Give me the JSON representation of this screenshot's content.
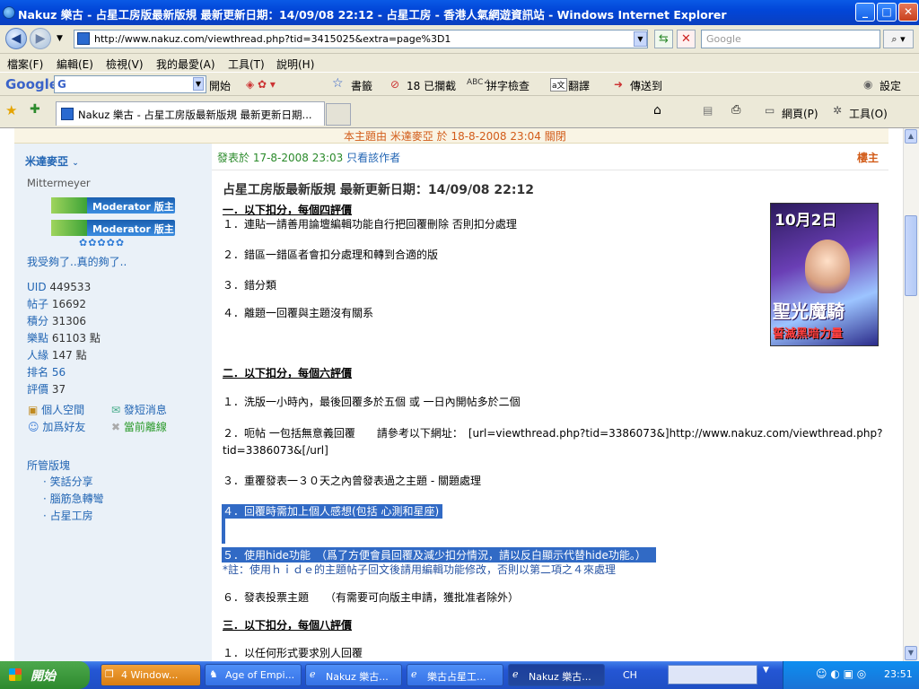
{
  "window": {
    "title": "Nakuz 樂古 - 占星工房版最新版規 最新更新日期：14/09/08 22:12 - 占星工房 - 香港人氣網遊資訊站 - Windows Internet Explorer",
    "btn_min": "_",
    "btn_max": "□",
    "btn_close": "✕"
  },
  "address": {
    "url": "http://www.nakuz.com/viewthread.php?tid=3415025&extra=page%3D1",
    "search_placeholder": "Google"
  },
  "menu": [
    "檔案(F)",
    "編輯(E)",
    "檢視(V)",
    "我的最愛(A)",
    "工具(T)",
    "說明(H)"
  ],
  "google_toolbar": {
    "logo": "Google",
    "g": "G",
    "go": "開始",
    "bookmarks": "書籤",
    "blocked": "18 已攔截",
    "spell": "拼字檢查",
    "translate": "翻譯",
    "send": "傳送到",
    "settings": "設定"
  },
  "tabs": {
    "active_tab": "Nakuz 樂古 - 占星工房版最新版規 最新更新日期...",
    "page_menu": "網頁(P)",
    "tools_menu": "工具(O)"
  },
  "top_notice": "本主題由 米達麥亞 於 18-8-2008 23:04 關閉",
  "author": {
    "name": "米達麥亞",
    "subname": "Mittermeyer",
    "badge1": "Moderator 版主",
    "badge2": "Moderator 版主",
    "stars": "✿✿✿✿✿",
    "signature": "我受夠了..真的夠了..",
    "stats": [
      {
        "label": "UID",
        "value": "449533"
      },
      {
        "label": "帖子",
        "value": "16692"
      },
      {
        "label": "積分",
        "value": "31306"
      },
      {
        "label": "樂點",
        "value": "61103 點"
      },
      {
        "label": "人緣",
        "value": "147 點"
      },
      {
        "label": "排名",
        "value": "56"
      },
      {
        "label": "評價",
        "value": "37"
      }
    ],
    "actions": {
      "space": "個人空間",
      "pm": "發短消息",
      "addfriend": "加爲好友",
      "offline": "當前離線"
    },
    "managed_title": "所管版塊",
    "managed": [
      "笑話分享",
      "腦筋急轉彎",
      "占星工房"
    ]
  },
  "post": {
    "meta": "發表於 17-8-2008 23:03",
    "only_author": "只看該作者",
    "floor": "樓主",
    "title": "占星工房版最新版規 最新更新日期：14/09/08 22:12",
    "sec1": "一．以下扣分，每個四評價",
    "s1l1": "１．連貼一請善用論壇編輯功能自行把回覆刪除 否則扣分處理",
    "s1l2": "２．錯區一錯區者會扣分處理和轉到合適的版",
    "s1l3": "３．錯分類",
    "s1l4": "４．離題一回覆與主題沒有關系",
    "sec2": "二．以下扣分，每個六評價",
    "s2l1": "１．洗版一小時內，最後回覆多於五個 或 一日內開帖多於二個",
    "s2l2a": "２．呃帖 一包括無意義回覆　　請參考以下網址：　[url=viewthread.php?tid=3386073&]http://www.nakuz.com/viewthread.php?",
    "s2l2b": "tid=3386073&[/url]",
    "s2l3": "３．重覆發表一３０天之內曾發表過之主題 - 關題處理",
    "s2l4": "４．回覆時需加上個人感想(包括 心測和星座)",
    "s2l5": "５．使用hide功能　（爲了方便會員回覆及減少扣分情況，請以反白顯示代替hide功能。）",
    "s2note": "*註：使用ｈｉｄｅ的主題帖子回文後請用編輯功能修改，否則以第二項之４來處理",
    "s2l6": "６．發表投票主題　　（有需要可向版主申請，獲批准者除外）",
    "sec3": "三．以下扣分，每個八評價",
    "s3l1": "１．以任何形式要求別人回覆"
  },
  "ad": {
    "date": "10月2日",
    "line1": "聖光魔騎",
    "line2": "誓滅黑暗力量"
  },
  "taskbar": {
    "start": "開始",
    "items": [
      "4 Window...",
      "Age of Empi...",
      "Nakuz 樂古...",
      "樂古占星工...",
      "Nakuz 樂古..."
    ],
    "lang": "CH",
    "time": "23:51"
  },
  "colors": {
    "title_blue": "#0246d8",
    "link_blue": "#2366b4",
    "notice_orange": "#d25c19",
    "selection": "#316ac5",
    "sidebar_bg": "#eaf1f8"
  }
}
